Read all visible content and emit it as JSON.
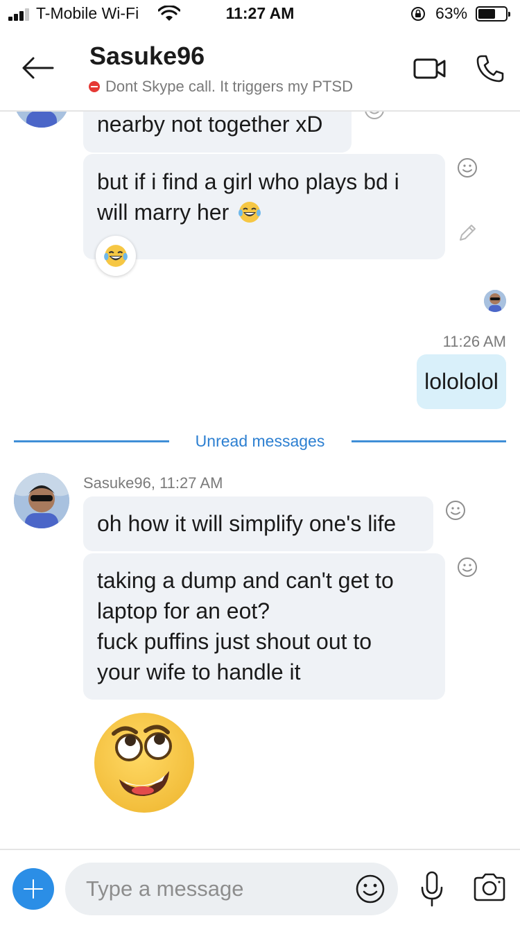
{
  "status_bar": {
    "carrier": "T-Mobile Wi-Fi",
    "time": "11:27 AM",
    "battery_percent": "63%",
    "battery_level": 0.63,
    "icons": [
      "signal-bars-icon",
      "wifi-icon",
      "rotation-lock-icon",
      "battery-icon"
    ]
  },
  "header": {
    "contact_name": "Sasuke96",
    "status_message": "Dont Skype call. It triggers my PTSD",
    "icons": [
      "back-arrow-icon",
      "video-call-icon",
      "phone-call-icon",
      "do-not-disturb-icon"
    ]
  },
  "chat": {
    "incoming_top": [
      {
        "text": "nearby not together xD"
      },
      {
        "line1": "but if i find a girl who plays bd i",
        "line2": "will marry her",
        "emoji": "laughing-tears-emoji",
        "reaction": "laughing-tears-emoji"
      }
    ],
    "outgoing": {
      "time": "11:26 AM",
      "text": "lolololol"
    },
    "divider": "Unread messages",
    "unread": {
      "sender_meta": "Sasuke96, 11:27 AM",
      "messages": [
        {
          "text": "oh how it will simplify one's life"
        },
        {
          "lines": [
            "taking a dump and can't get to",
            "laptop for an eot?",
            "fuck puffins just shout out to",
            "your wife to handle it"
          ]
        }
      ],
      "sticker": "eye-roll-smile-emoji"
    }
  },
  "composer": {
    "placeholder": "Type a message",
    "icons": [
      "plus-icon",
      "emoji-icon",
      "microphone-icon",
      "camera-icon"
    ]
  },
  "colors": {
    "accent_blue": "#2c7fd1",
    "incoming_bubble": "#eff2f6",
    "outgoing_bubble": "#d9f0fa",
    "dnd_red": "#e53935"
  }
}
